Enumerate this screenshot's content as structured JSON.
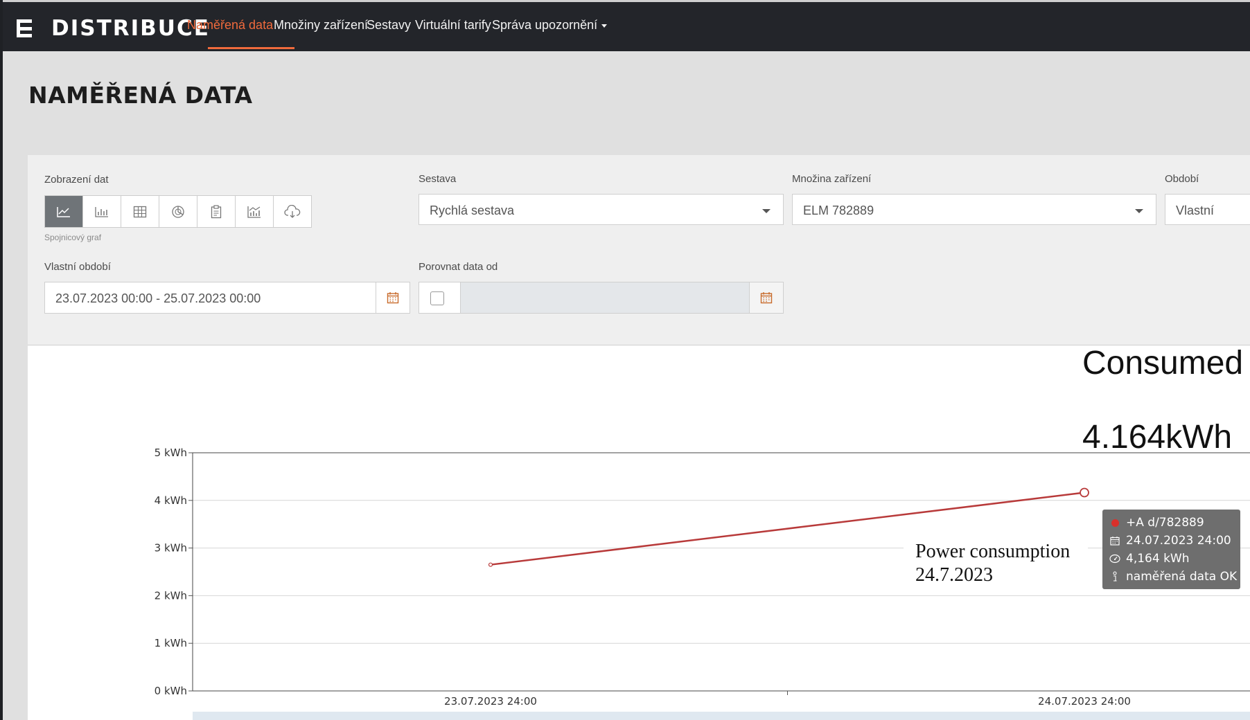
{
  "brand": {
    "name": "DISTRIBUCE"
  },
  "nav": {
    "items": [
      {
        "label": "Naměřená data",
        "active": true
      },
      {
        "label": "Množiny zařízení"
      },
      {
        "label": "Sestavy"
      },
      {
        "label": "Virtuální tarify"
      },
      {
        "label": "Správa upozornění"
      }
    ]
  },
  "page": {
    "title": "NAMĚŘENÁ DATA"
  },
  "filters": {
    "view_label": "Zobrazení dat",
    "view_buttons": [
      "line-chart-icon",
      "bar-chart-icon",
      "table-icon",
      "pie-chart-icon",
      "clipboard-icon",
      "combo-chart-icon",
      "cloud-download-icon"
    ],
    "view_selected_caption": "Spojnicový graf",
    "report_label": "Sestava",
    "report_value": "Rychlá sestava",
    "device_set_label": "Množina zařízení",
    "device_set_value": "ELM 782889",
    "period_label": "Období",
    "period_value": "Vlastní",
    "custom_period_label": "Vlastní období",
    "custom_period_value": "23.07.2023 00:00 - 25.07.2023 00:00",
    "compare_label": "Porovnat data od",
    "compare_checked": false
  },
  "chart_data": {
    "type": "line",
    "x": [
      "23.07.2023 24:00",
      "24.07.2023 24:00"
    ],
    "series": [
      {
        "name": "+A d/782889",
        "color": "#b83a3a",
        "values": [
          2.65,
          4.164
        ]
      }
    ],
    "y_ticks": [
      "0 kWh",
      "1 kWh",
      "2 kWh",
      "3 kWh",
      "4 kWh",
      "5 kWh"
    ],
    "ylim": [
      0,
      5
    ],
    "grid": true
  },
  "tooltip": {
    "series": "+A d/782889",
    "datetime": "24.07.2023 24:00",
    "value": "4,164 kWh",
    "status": "naměřená data OK"
  },
  "annotations": {
    "consumed_label": "Consumed",
    "consumed_value": "4.164kWh",
    "power_line1": "Power consumption",
    "power_line2": "24.7.2023"
  },
  "colors": {
    "accent": "#f06a3c",
    "navbar": "#23252a",
    "series": "#b83a3a"
  }
}
